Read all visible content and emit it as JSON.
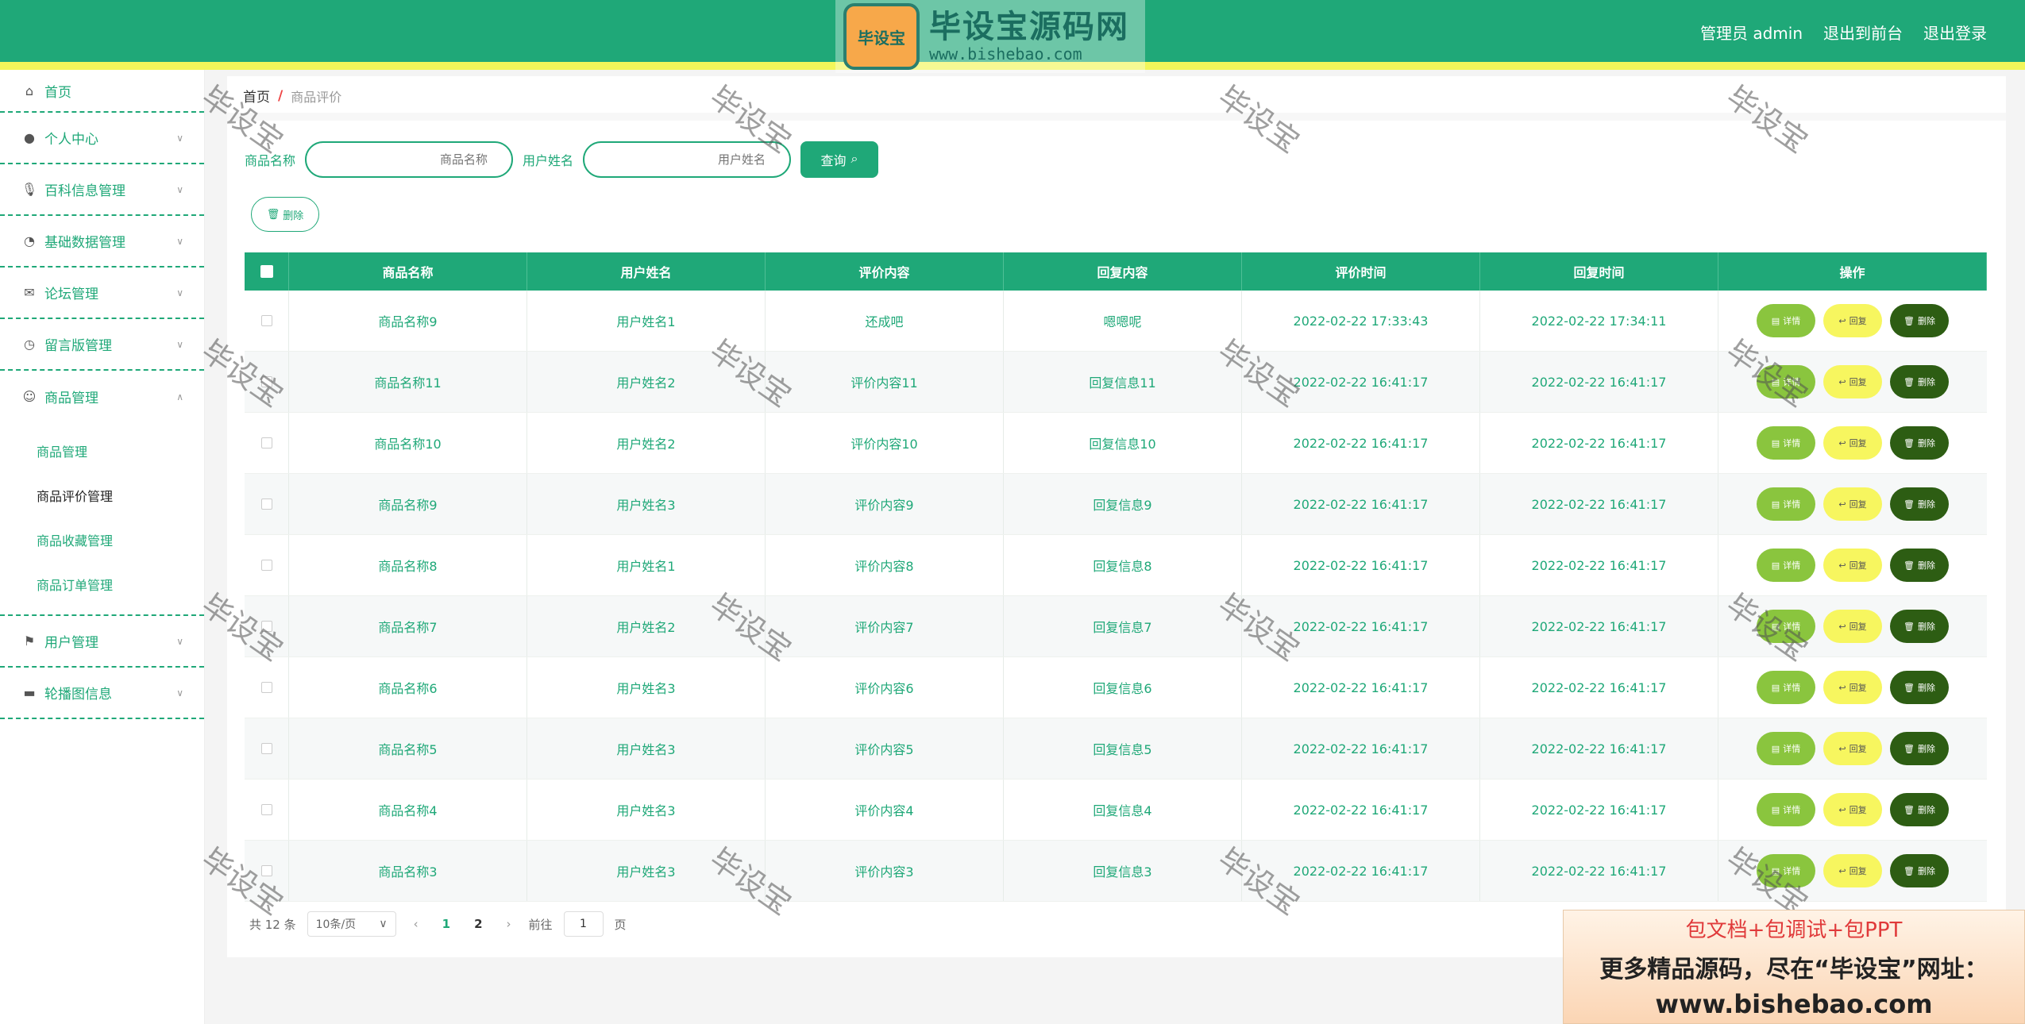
{
  "header": {
    "logo_badge": "毕设宝",
    "logo_title": "毕设宝源码网",
    "logo_url": "www.bishebao.com",
    "user": "管理员 admin",
    "front_link": "退出到前台",
    "logout_link": "退出登录"
  },
  "sidebar": {
    "items": [
      {
        "label": "首页",
        "icon": "home-icon"
      },
      {
        "label": "个人中心",
        "icon": "user-icon"
      },
      {
        "label": "百科信息管理",
        "icon": "mic-icon"
      },
      {
        "label": "基础数据管理",
        "icon": "dashboard-icon"
      },
      {
        "label": "论坛管理",
        "icon": "mail-icon"
      },
      {
        "label": "留言版管理",
        "icon": "clock-icon"
      },
      {
        "label": "商品管理",
        "icon": "smile-icon"
      },
      {
        "label": "用户管理",
        "icon": "flag-icon"
      },
      {
        "label": "轮播图信息",
        "icon": "monitor-icon"
      }
    ],
    "subitems": [
      {
        "label": "商品管理"
      },
      {
        "label": "商品评价管理"
      },
      {
        "label": "商品收藏管理"
      },
      {
        "label": "商品订单管理"
      }
    ]
  },
  "breadcrumb": {
    "home": "首页",
    "sep": "/",
    "current": "商品评价"
  },
  "search": {
    "product_label": "商品名称",
    "product_placeholder": "商品名称",
    "user_label": "用户姓名",
    "user_placeholder": "用户姓名",
    "query_label": "查询"
  },
  "toolbar": {
    "delete_label": "删除"
  },
  "table": {
    "headers": [
      "商品名称",
      "用户姓名",
      "评价内容",
      "回复内容",
      "评价时间",
      "回复时间",
      "操作"
    ],
    "rows": [
      {
        "product": "商品名称9",
        "user": "用户姓名1",
        "content": "还成吧",
        "reply": "嗯嗯呢",
        "eval_time": "2022-02-22 17:33:43",
        "reply_time": "2022-02-22 17:34:11"
      },
      {
        "product": "商品名称11",
        "user": "用户姓名2",
        "content": "评价内容11",
        "reply": "回复信息11",
        "eval_time": "2022-02-22 16:41:17",
        "reply_time": "2022-02-22 16:41:17"
      },
      {
        "product": "商品名称10",
        "user": "用户姓名2",
        "content": "评价内容10",
        "reply": "回复信息10",
        "eval_time": "2022-02-22 16:41:17",
        "reply_time": "2022-02-22 16:41:17"
      },
      {
        "product": "商品名称9",
        "user": "用户姓名3",
        "content": "评价内容9",
        "reply": "回复信息9",
        "eval_time": "2022-02-22 16:41:17",
        "reply_time": "2022-02-22 16:41:17"
      },
      {
        "product": "商品名称8",
        "user": "用户姓名1",
        "content": "评价内容8",
        "reply": "回复信息8",
        "eval_time": "2022-02-22 16:41:17",
        "reply_time": "2022-02-22 16:41:17"
      },
      {
        "product": "商品名称7",
        "user": "用户姓名2",
        "content": "评价内容7",
        "reply": "回复信息7",
        "eval_time": "2022-02-22 16:41:17",
        "reply_time": "2022-02-22 16:41:17"
      },
      {
        "product": "商品名称6",
        "user": "用户姓名3",
        "content": "评价内容6",
        "reply": "回复信息6",
        "eval_time": "2022-02-22 16:41:17",
        "reply_time": "2022-02-22 16:41:17"
      },
      {
        "product": "商品名称5",
        "user": "用户姓名3",
        "content": "评价内容5",
        "reply": "回复信息5",
        "eval_time": "2022-02-22 16:41:17",
        "reply_time": "2022-02-22 16:41:17"
      },
      {
        "product": "商品名称4",
        "user": "用户姓名3",
        "content": "评价内容4",
        "reply": "回复信息4",
        "eval_time": "2022-02-22 16:41:17",
        "reply_time": "2022-02-22 16:41:17"
      },
      {
        "product": "商品名称3",
        "user": "用户姓名3",
        "content": "评价内容3",
        "reply": "回复信息3",
        "eval_time": "2022-02-22 16:41:17",
        "reply_time": "2022-02-22 16:41:17"
      }
    ],
    "actions": {
      "detail": "详情",
      "reply": "回复",
      "delete": "删除"
    }
  },
  "pagination": {
    "total": "共 12 条",
    "page_size": "10条/页",
    "pages": [
      "1",
      "2"
    ],
    "jump_prefix": "前往",
    "jump_value": "1",
    "jump_suffix": "页"
  },
  "watermark": "毕设宝",
  "ad": {
    "line1": "包文档+包调试+包PPT",
    "line2": "更多精品源码，尽在“毕设宝”网址：",
    "line3": "www.bishebao.com"
  },
  "colors": {
    "primary": "#1fa878",
    "strip": "#f2f65a",
    "detail_button": "#8ac53e",
    "reply_button": "#f7f65f",
    "delete_button": "#2d5d13"
  }
}
